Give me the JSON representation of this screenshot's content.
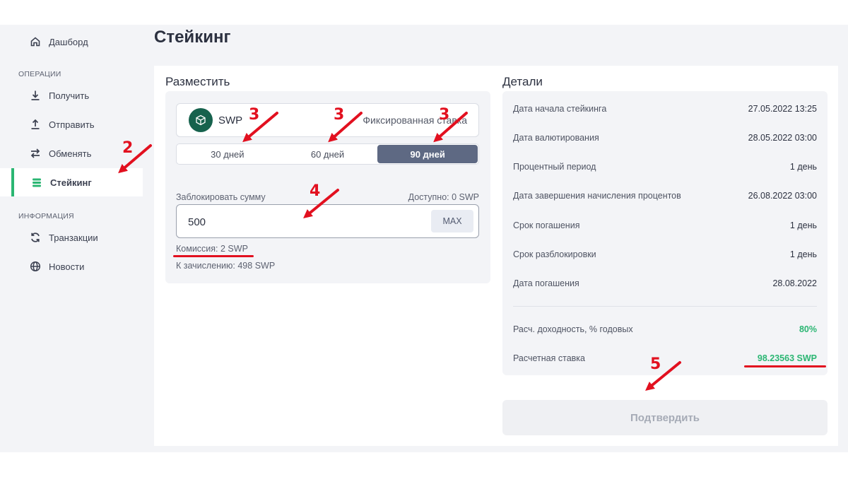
{
  "sidebar": {
    "dashboard": {
      "label": "Дашборд",
      "icon": "home-icon"
    },
    "operations_section": "ОПЕРАЦИИ",
    "items_ops": [
      {
        "label": "Получить",
        "icon": "download-icon"
      },
      {
        "label": "Отправить",
        "icon": "upload-icon"
      },
      {
        "label": "Обменять",
        "icon": "swap-icon"
      },
      {
        "label": "Стейкинг",
        "icon": "staking-icon",
        "active": true
      }
    ],
    "info_section": "ИНФОРМАЦИЯ",
    "items_info": [
      {
        "label": "Транзакции",
        "icon": "refresh-icon"
      },
      {
        "label": "Новости",
        "icon": "globe-icon"
      }
    ],
    "active_accent": "#2bb673"
  },
  "page": {
    "title": "Стейкинг"
  },
  "place": {
    "title": "Разместить",
    "token": {
      "name": "SWP",
      "type": "Фиксированная ставка",
      "icon": "cube-icon"
    },
    "periods": [
      {
        "label": "30 дней",
        "selected": false
      },
      {
        "label": "60 дней",
        "selected": false
      },
      {
        "label": "90 дней",
        "selected": true
      }
    ],
    "lock_label": "Заблокировать сумму",
    "available": "Доступно: 0 SWP",
    "amount": "500",
    "max_label": "MAX",
    "fee": "Комиссия: 2 SWP",
    "credit": "К зачислению: 498 SWP"
  },
  "details": {
    "title": "Детали",
    "rows": [
      {
        "label": "Дата начала стейкинга",
        "value": "27.05.2022 13:25"
      },
      {
        "label": "Дата валютирования",
        "value": "28.05.2022 03:00"
      },
      {
        "label": "Процентный период",
        "value": "1 день"
      },
      {
        "label": "Дата завершения начисления процентов",
        "value": "26.08.2022 03:00"
      },
      {
        "label": "Срок погашения",
        "value": "1 день"
      },
      {
        "label": "Срок разблокировки",
        "value": "1 день"
      },
      {
        "label": "Дата погашения",
        "value": "28.08.2022"
      }
    ],
    "yield_label": "Расч. доходность, % годовых",
    "yield_value": "80%",
    "rate_label": "Расчетная ставка",
    "rate_value": "98.23563 SWP",
    "accent": "#2bb673"
  },
  "confirm_label": "Подтвердить",
  "annotations": {
    "color": "#e2101f",
    "numbers": [
      "2",
      "3",
      "3",
      "3",
      "4",
      "5"
    ]
  }
}
